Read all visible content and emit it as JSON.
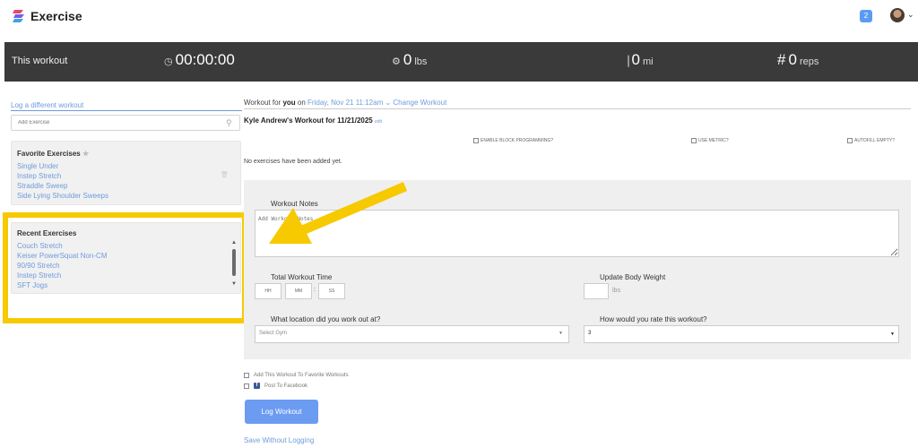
{
  "app": {
    "title": "Exercise",
    "notification_count": "2"
  },
  "stats": {
    "label": "This workout",
    "time": "00:00:00",
    "weight_value": "0",
    "weight_unit": "lbs",
    "distance_value": "0",
    "distance_unit": "mi",
    "reps_prefix": "#",
    "reps_value": "0",
    "reps_unit": "reps"
  },
  "sidebar": {
    "log_different": "Log a different workout",
    "add_exercise_placeholder": "Add Exercise",
    "favorites": {
      "title": "Favorite Exercises",
      "items": [
        "Single Under",
        "Instep Stretch",
        "Straddle Sweep",
        "Side Lying Shoulder Sweeps"
      ]
    },
    "recent": {
      "title": "Recent Exercises",
      "items": [
        "Couch Stretch",
        "Keiser PowerSquat Non-CM",
        "90/90 Stretch",
        "Instep Stretch",
        "SFT Jogs"
      ]
    }
  },
  "main": {
    "header_prefix": "Workout for",
    "header_user": "you",
    "header_on": "on",
    "header_date": "Friday, Nov 21 11:12am",
    "change_workout": "Change Workout",
    "workout_title": "Kyle Andrew's Workout for 11/21/2025",
    "edit_label": "edit",
    "options": {
      "block_programming": "ENABLE BLOCK PROGRAMMING?",
      "use_metric": "USE METRIC?",
      "autofill_empty": "AUTOFILL EMPTY?"
    },
    "no_exercises": "No exercises have been added yet.",
    "notes_label": "Workout Notes",
    "notes_placeholder": "Add Workout Notes",
    "total_time_label": "Total Workout Time",
    "time_hh": "HH",
    "time_mm": "MM",
    "time_ss": "SS",
    "body_weight_label": "Update Body Weight",
    "body_weight_unit": "lbs",
    "location_label": "What location did you work out at?",
    "location_placeholder": "Select Gym",
    "rating_label": "How would you rate this workout?",
    "rating_value": "3",
    "favorite_checkbox": "Add This Workout To Favorite Workouts",
    "facebook_checkbox": "Post To Facebook",
    "log_button": "Log Workout",
    "save_without": "Save Without Logging"
  },
  "colors": {
    "accent": "#6f9bdc",
    "button": "#6b9cf2",
    "highlight": "#f7c900",
    "statsbar": "#3a3a3a"
  },
  "icons": [
    "logo-icon",
    "notification-badge",
    "avatar",
    "stopwatch-icon",
    "weight-icon",
    "shoe-icon",
    "search-icon",
    "star-icon",
    "trash-icon",
    "facebook-icon",
    "arrow-annotation"
  ]
}
